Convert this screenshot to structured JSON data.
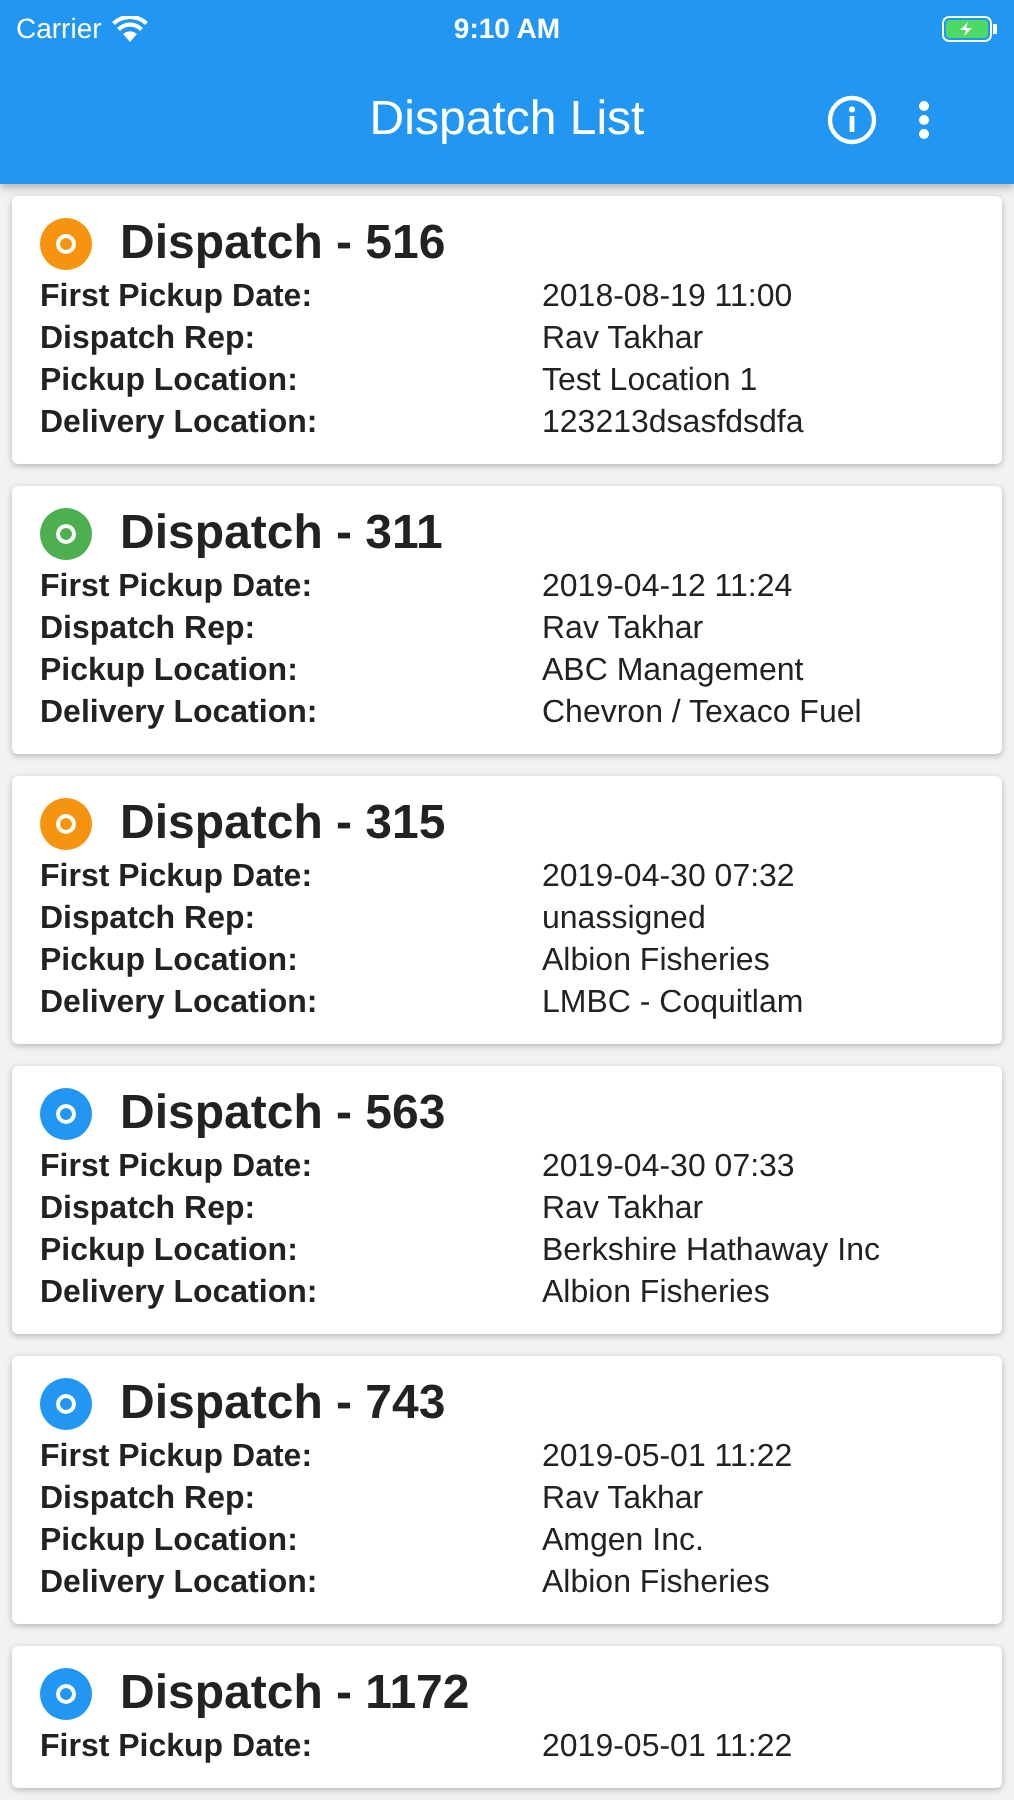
{
  "status_bar": {
    "carrier": "Carrier",
    "time": "9:10 AM"
  },
  "app_bar": {
    "title": "Dispatch List"
  },
  "dispatches": [
    {
      "title": "Dispatch - 516",
      "color": "#f7940f",
      "fields": [
        {
          "label": "First Pickup Date:",
          "value": "2018-08-19 11:00"
        },
        {
          "label": "Dispatch Rep:",
          "value": "Rav Takhar"
        },
        {
          "label": "Pickup Location:",
          "value": "Test Location 1"
        },
        {
          "label": "Delivery Location:",
          "value": "123213dsasfdsdfa"
        }
      ]
    },
    {
      "title": "Dispatch - 311",
      "color": "#4caf50",
      "fields": [
        {
          "label": "First Pickup Date:",
          "value": "2019-04-12 11:24"
        },
        {
          "label": "Dispatch Rep:",
          "value": "Rav Takhar"
        },
        {
          "label": "Pickup Location:",
          "value": "ABC Management"
        },
        {
          "label": "Delivery Location:",
          "value": "Chevron / Texaco Fuel"
        }
      ]
    },
    {
      "title": "Dispatch - 315",
      "color": "#f7940f",
      "fields": [
        {
          "label": "First Pickup Date:",
          "value": "2019-04-30 07:32"
        },
        {
          "label": "Dispatch Rep:",
          "value": "unassigned"
        },
        {
          "label": "Pickup Location:",
          "value": "Albion Fisheries"
        },
        {
          "label": "Delivery Location:",
          "value": "LMBC - Coquitlam"
        }
      ]
    },
    {
      "title": "Dispatch - 563",
      "color": "#2196f3",
      "fields": [
        {
          "label": "First Pickup Date:",
          "value": "2019-04-30 07:33"
        },
        {
          "label": "Dispatch Rep:",
          "value": "Rav Takhar"
        },
        {
          "label": "Pickup Location:",
          "value": "Berkshire Hathaway Inc"
        },
        {
          "label": "Delivery Location:",
          "value": "Albion Fisheries"
        }
      ]
    },
    {
      "title": "Dispatch - 743",
      "color": "#2196f3",
      "fields": [
        {
          "label": "First Pickup Date:",
          "value": "2019-05-01 11:22"
        },
        {
          "label": "Dispatch Rep:",
          "value": "Rav Takhar"
        },
        {
          "label": "Pickup Location:",
          "value": "Amgen Inc."
        },
        {
          "label": "Delivery Location:",
          "value": "Albion Fisheries"
        }
      ]
    },
    {
      "title": "Dispatch - 1172",
      "color": "#2196f3",
      "fields": [
        {
          "label": "First Pickup Date:",
          "value": "2019-05-01 11:22"
        }
      ]
    }
  ]
}
